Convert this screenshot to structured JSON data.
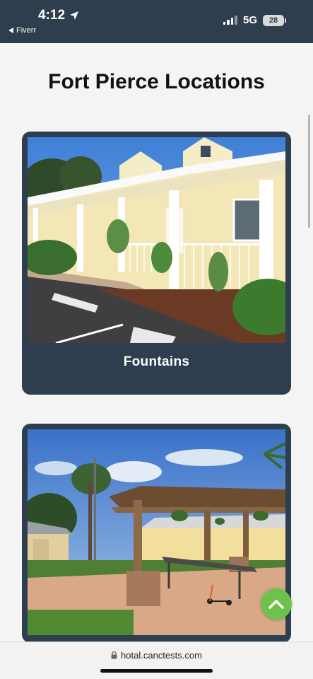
{
  "status_bar": {
    "time": "4:12",
    "back_app": "Fiverr",
    "network": "5G",
    "battery": "28"
  },
  "page": {
    "title": "Fort Pierce Locations"
  },
  "cards": [
    {
      "title": "Fountains"
    },
    {
      "title": ""
    }
  ],
  "browser": {
    "url": "hotal.canctests.com"
  },
  "colors": {
    "header_bg": "#2f3e4e",
    "card_bg": "#2f3e4e",
    "accent_green": "#6cc24a"
  },
  "icons": {
    "location": "location-arrow-icon",
    "back": "back-triangle-icon",
    "scroll_top": "chevron-up-icon",
    "lock": "lock-icon"
  }
}
